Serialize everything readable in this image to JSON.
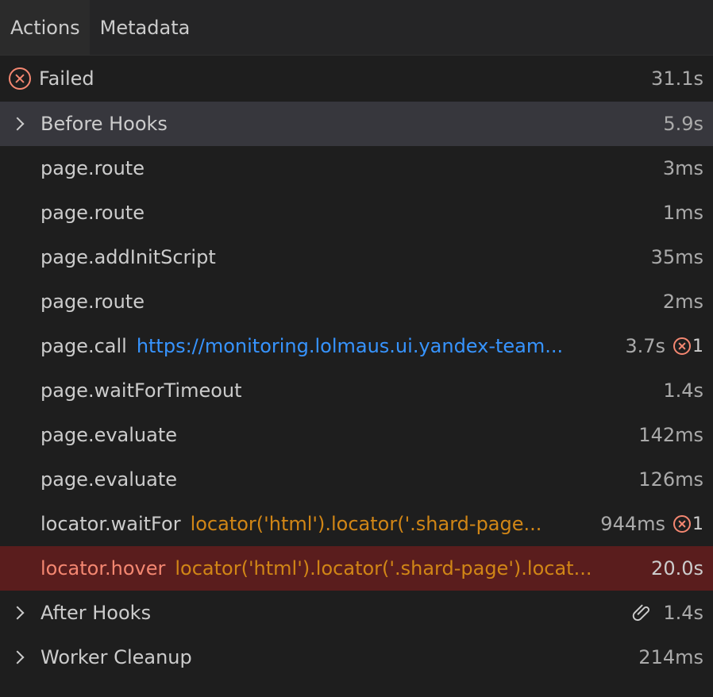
{
  "tabs": [
    {
      "label": "Actions",
      "active": true
    },
    {
      "label": "Metadata",
      "active": false
    }
  ],
  "status": {
    "label": "Failed",
    "duration": "31.1s",
    "color": "#f48771"
  },
  "groups": {
    "before_hooks": {
      "label": "Before Hooks",
      "duration": "5.9s"
    },
    "after_hooks": {
      "label": "After Hooks",
      "duration": "1.4s",
      "icon": "paperclip-icon"
    },
    "worker_cleanup": {
      "label": "Worker Cleanup",
      "duration": "214ms"
    }
  },
  "actions": [
    {
      "title": "page.route",
      "param": "",
      "duration": "3ms"
    },
    {
      "title": "page.route",
      "param": "",
      "duration": "1ms"
    },
    {
      "title": "page.addInitScript",
      "param": "",
      "duration": "35ms"
    },
    {
      "title": "page.route",
      "param": "",
      "duration": "2ms"
    },
    {
      "title": "page.call",
      "param": "https://monitoring.lolmaus.ui.yandex-team...",
      "duration": "3.7s",
      "errors": "1"
    },
    {
      "title": "page.waitForTimeout",
      "param": "",
      "duration": "1.4s"
    },
    {
      "title": "page.evaluate",
      "param": "",
      "duration": "142ms"
    },
    {
      "title": "page.evaluate",
      "param": "",
      "duration": "126ms"
    },
    {
      "title": "locator.waitFor",
      "param": "locator('html').locator('.shard-page...",
      "duration": "944ms",
      "errors": "1"
    },
    {
      "title": "locator.hover",
      "param": "locator('html').locator('.shard-page').locat...",
      "duration": "20.0s",
      "selected_failed": true
    }
  ],
  "colors": {
    "background": "#1e1e1e",
    "group_highlight": "#37373d",
    "failed_row": "#5a1d1d",
    "link": "#3794ff",
    "locator": "#d18616",
    "error": "#f48771"
  }
}
